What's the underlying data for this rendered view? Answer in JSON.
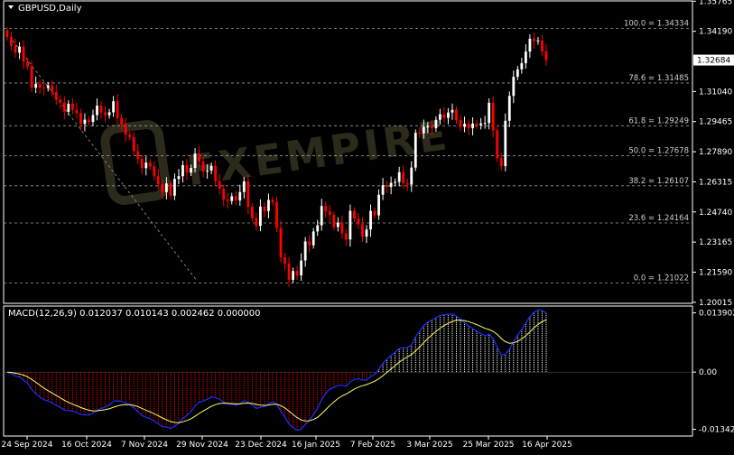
{
  "header": {
    "symbol_label": "GBPUSD,Daily",
    "macd_label": "MACD(12,26,9) 0.012037 0.010143 0.002462 0.000000"
  },
  "chart_data": {
    "type": "candlestick",
    "symbol": "GBPUSD",
    "timeframe": "Daily",
    "price_axis": {
      "ylim": [
        1.1996,
        1.3578
      ],
      "ticks": [
        "1.35765",
        "1.34190",
        "1.31040",
        "1.29465",
        "1.27890",
        "1.26315",
        "1.24740",
        "1.23165",
        "1.21590",
        "1.20015"
      ],
      "current_price": "1.32684"
    },
    "time_axis": {
      "ticks": [
        "24 Sep 2024",
        "16 Oct 2024",
        "7 Nov 2024",
        "29 Nov 2024",
        "23 Dec 2024",
        "16 Jan 2025",
        "7 Feb 2025",
        "3 Mar 2025",
        "25 Mar 2025",
        "16 Apr 2025"
      ]
    },
    "fibonacci_levels": [
      {
        "label": "100.0 = 1.34334",
        "value": 1.34334
      },
      {
        "label": "78.6 = 1.31485",
        "value": 1.31485
      },
      {
        "label": "61.8 = 1.29249",
        "value": 1.29249
      },
      {
        "label": "50.0 = 1.27678",
        "value": 1.27678
      },
      {
        "label": "38.2 = 1.26107",
        "value": 1.26107
      },
      {
        "label": "23.6 = 1.24164",
        "value": 1.24164
      },
      {
        "label": "0.0 = 1.21022",
        "value": 1.21022
      }
    ],
    "closes": [
      1.3389,
      1.3342,
      1.3307,
      1.3339,
      1.3261,
      1.3236,
      1.3124,
      1.3144,
      1.3125,
      1.3122,
      1.3136,
      1.3101,
      1.3061,
      1.3046,
      1.2998,
      1.304,
      1.3009,
      1.2991,
      1.2934,
      1.2957,
      1.2945,
      1.2981,
      1.303,
      1.2995,
      1.298,
      1.2995,
      1.3053,
      1.2965,
      1.2933,
      1.2878,
      1.2866,
      1.2792,
      1.2752,
      1.2703,
      1.2732,
      1.2712,
      1.2661,
      1.262,
      1.2578,
      1.2623,
      1.2559,
      1.2647,
      1.2661,
      1.2719,
      1.268,
      1.2704,
      1.278,
      1.2738,
      1.2686,
      1.269,
      1.2715,
      1.2635,
      1.2595,
      1.2539,
      1.2531,
      1.2556,
      1.2534,
      1.2578,
      1.2634,
      1.2501,
      1.2441,
      1.2401,
      1.2502,
      1.2479,
      1.2537,
      1.2525,
      1.2391,
      1.2237,
      1.2204,
      1.2119,
      1.2165,
      1.2142,
      1.222,
      1.232,
      1.23,
      1.2372,
      1.2404,
      1.2505,
      1.2477,
      1.2459,
      1.2395,
      1.2418,
      1.2362,
      1.233,
      1.248,
      1.244,
      1.241,
      1.2345,
      1.2382,
      1.248,
      1.2456,
      1.2564,
      1.2614,
      1.2605,
      1.2626,
      1.2631,
      1.2682,
      1.2625,
      1.2617,
      1.2706,
      1.2888,
      1.2885,
      1.2919,
      1.2921,
      1.2912,
      1.2956,
      1.2985,
      1.2966,
      1.2994,
      1.3008,
      1.2954,
      1.2919,
      1.2935,
      1.2912,
      1.2936,
      1.2928,
      1.2937,
      1.2939,
      1.3045,
      1.2901,
      1.2755,
      1.2714,
      1.2951,
      1.3081,
      1.3181,
      1.322,
      1.3252,
      1.3313,
      1.338,
      1.3367,
      1.3371,
      1.3314,
      1.3268
    ],
    "macd": {
      "label": "MACD(12,26,9)",
      "values": [
        "0.012037",
        "0.010143",
        "0.002462",
        "0.000000"
      ],
      "axis_ticks": [
        "0.013902",
        "0.00",
        "-0.013425"
      ],
      "ylim": [
        -0.015,
        0.0155
      ]
    }
  },
  "watermark": "FXEMPIRE"
}
